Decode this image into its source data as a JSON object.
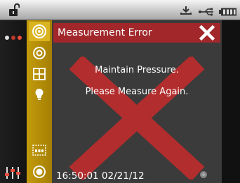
{
  "status_bar": {
    "icons": [
      "lock-open-icon",
      "usb-icon",
      "battery-icon"
    ]
  },
  "left_rail": {
    "icons": [
      "more-dots-icon",
      "sliders-icon"
    ],
    "dot_colors": [
      "#e0e0e0",
      "#c0392b",
      "#e74c3c"
    ]
  },
  "toolbar": {
    "tools": [
      "measure-target-icon",
      "sample-target-icon",
      "grid-icon",
      "lightbulb-icon",
      "strip-icon",
      "record-icon"
    ],
    "accent": "#b08a05"
  },
  "dialog": {
    "title": "Measurement Error",
    "message_line1": "Maintain Pressure.",
    "message_line2": "Please Measure Again.",
    "timestamp": "16:50:01 02/21/12",
    "title_color": "#a1272b",
    "x_color": "#b22d2d"
  }
}
